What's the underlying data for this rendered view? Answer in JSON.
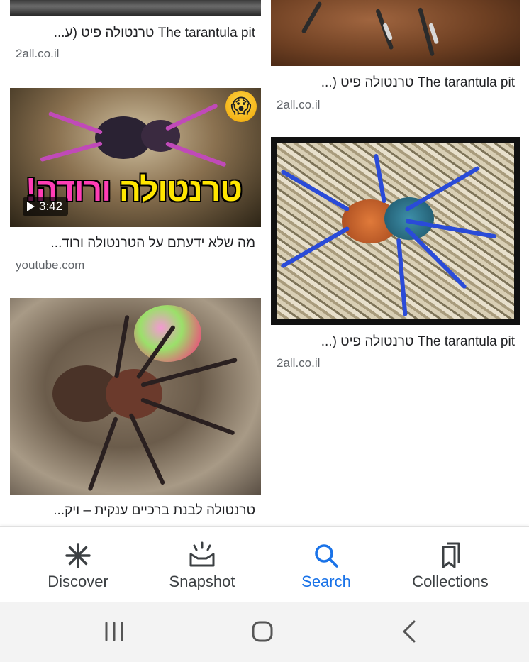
{
  "results": [
    {
      "title": "The tarantula pit טרנטולה פיט (ע...",
      "source": "2all.co.il",
      "column": "left"
    },
    {
      "title": "The tarantula pit טרנטולה פיט (...",
      "source": "2all.co.il",
      "column": "right"
    },
    {
      "title": "מה שלא ידעתם על הטרנטולה ורוד...",
      "source": "youtube.com",
      "column": "left",
      "duration": "3:42",
      "overlay_text_yellow": "טרנטולה",
      "overlay_text_pink": "ורודה!",
      "emoji": "😱"
    },
    {
      "title": "The tarantula pit טרנטולה פיט (...",
      "source": "2all.co.il",
      "column": "right"
    },
    {
      "title": "טרנטולה לבנת ברכיים ענקית – ויק...",
      "source": "",
      "column": "left"
    }
  ],
  "bottom_nav": {
    "items": [
      {
        "label": "Discover",
        "icon": "discover-asterisk-icon",
        "active": false
      },
      {
        "label": "Snapshot",
        "icon": "snapshot-icon",
        "active": false
      },
      {
        "label": "Search",
        "icon": "search-icon",
        "active": true
      },
      {
        "label": "Collections",
        "icon": "collections-bookmark-icon",
        "active": false
      }
    ],
    "active_color": "#1a73e8"
  },
  "system_nav": {
    "buttons": [
      "recents-icon",
      "home-icon",
      "back-icon"
    ]
  }
}
